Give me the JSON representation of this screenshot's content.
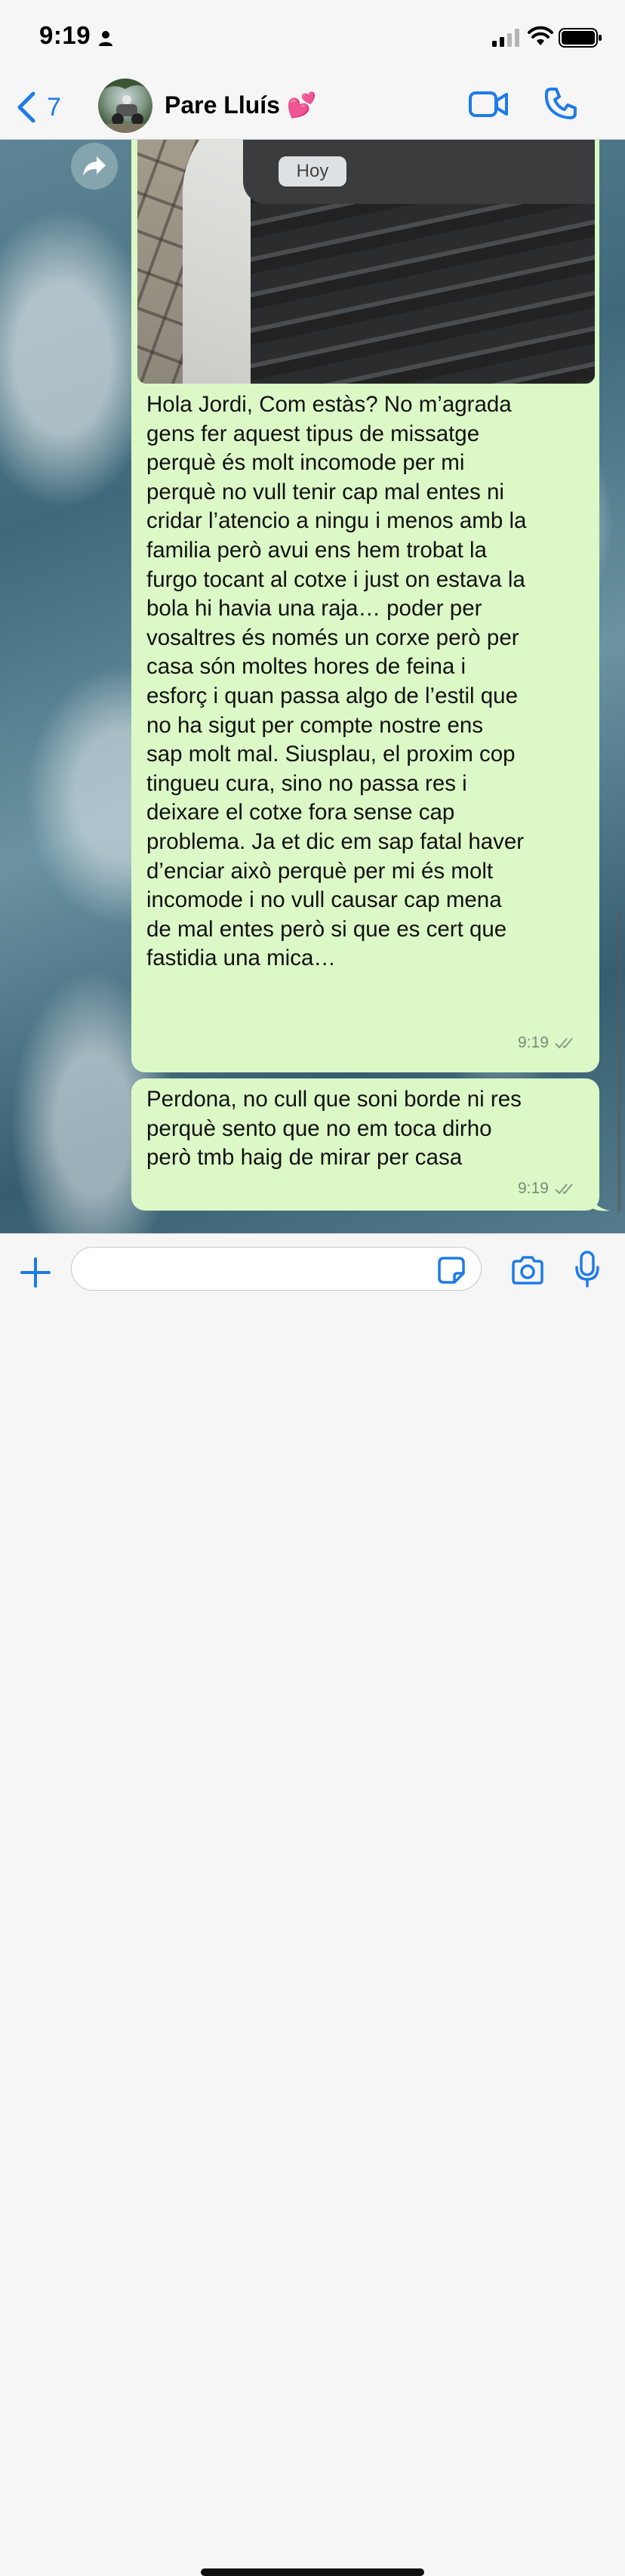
{
  "status_bar": {
    "time": "9:19"
  },
  "header": {
    "back_count": "7",
    "contact_name": "Pare Lluís 💕"
  },
  "chat": {
    "date_label": "Hoy",
    "message1": {
      "lines": [
        "Hola Jordi,  Com estàs? No m’agrada",
        "gens fer aquest tipus de missatge",
        "perquè és molt incomode per mi",
        "perquè no vull tenir cap mal entes ni",
        "cridar l’atencio a ningu i menos amb la",
        "familia però avui ens hem trobat la",
        "furgo tocant al cotxe i just on estava la",
        "bola hi havia una raja… poder per",
        "vosaltres és només un corxe però per",
        "casa són moltes hores de feina i",
        "esforç i quan passa algo de l’estil que",
        "no ha sigut per compte nostre ens",
        "sap molt mal. Siusplau, el proxim cop",
        "tingueu cura, sino no passa res i",
        "deixare el cotxe fora sense cap",
        "problema. Ja et dic em sap fatal haver",
        "d’enciar això perquè per mi és molt",
        "incomode i no vull causar cap mena",
        "de mal entes però si que es cert que",
        "fastidia una mica…"
      ],
      "time": "9:19"
    },
    "message2": {
      "lines": [
        "Perdona, no cull que soni borde ni res",
        "perquè sento que no em toca dirho",
        "però tmb haig de mirar per casa"
      ],
      "time": "9:19"
    }
  },
  "input": {
    "placeholder": "",
    "value": ""
  },
  "colors": {
    "accent": "#1e7be8",
    "bubble_out": "#dcf8c6",
    "bar_bg": "#f6f6f6"
  },
  "icons": [
    "person-icon",
    "signal-icon",
    "wifi-icon",
    "battery-icon",
    "back-chevron-icon",
    "video-call-icon",
    "phone-icon",
    "forward-icon",
    "read-ticks-icon",
    "plus-icon",
    "sticker-icon",
    "camera-icon",
    "microphone-icon"
  ]
}
